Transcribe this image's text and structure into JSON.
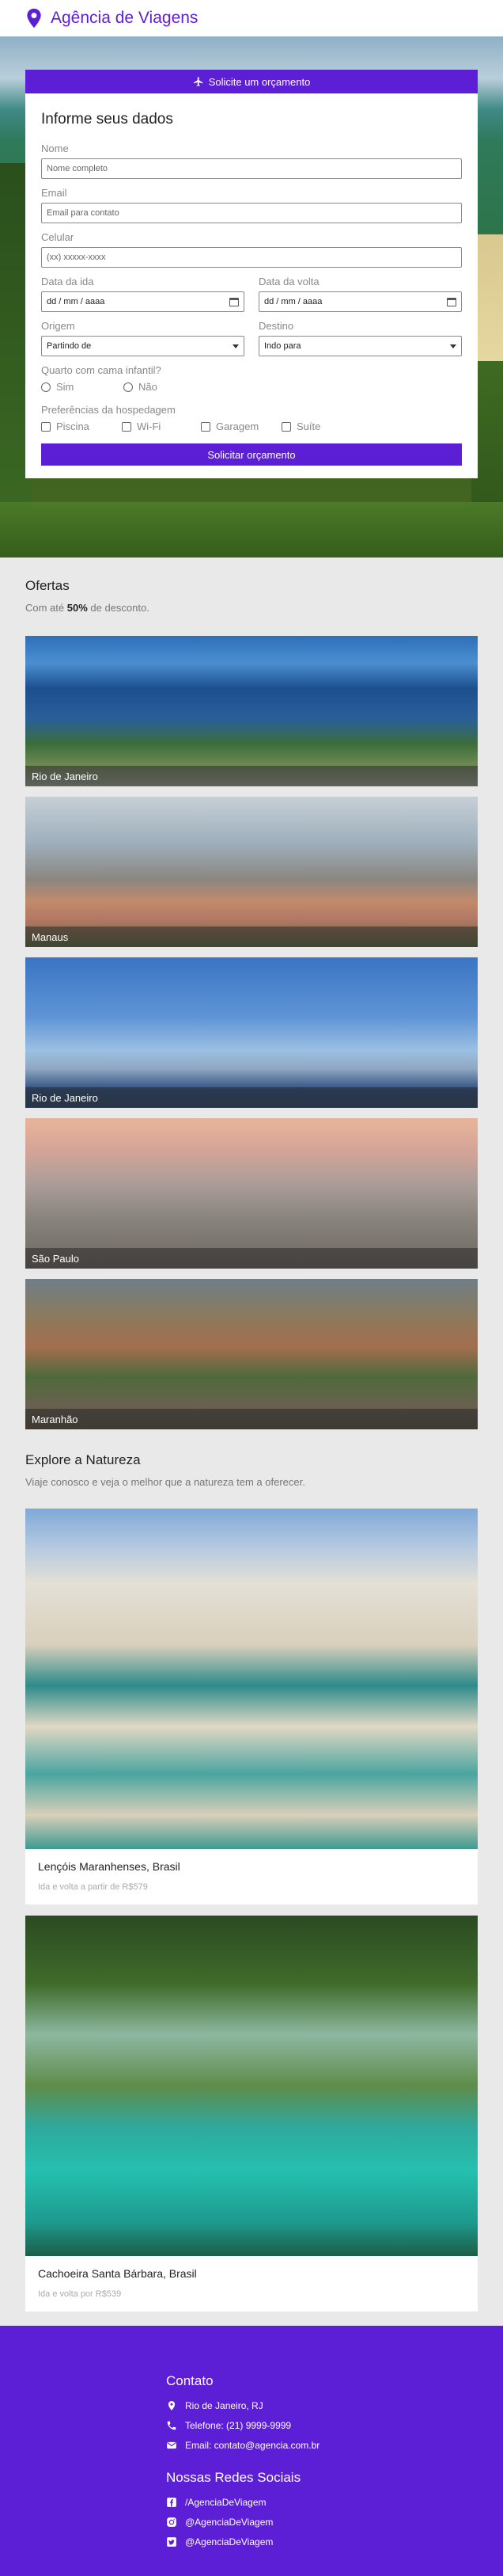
{
  "header": {
    "brand": "Agência de Viagens"
  },
  "quote": {
    "banner_label": "Solicite um orçamento",
    "title": "Informe seus dados",
    "name_label": "Nome",
    "name_placeholder": "Nome completo",
    "email_label": "Email",
    "email_placeholder": "Email para contato",
    "phone_label": "Celular",
    "phone_placeholder": "(xx) xxxxx-xxxx",
    "departure_label": "Data da ida",
    "return_label": "Data da volta",
    "date_placeholder": "dd / mm / aaaa",
    "origin_label": "Origem",
    "origin_value": "Partindo de",
    "destination_label": "Destino",
    "destination_value": "Indo para",
    "crib_question": "Quarto com cama infantil?",
    "crib_yes": "Sim",
    "crib_no": "Não",
    "prefs_label": "Preferências da hospedagem",
    "pref_pool": "Piscina",
    "pref_wifi": "Wi-Fi",
    "pref_garage": "Garagem",
    "pref_suite": "Suíte",
    "submit_label": "Solicitar orçamento"
  },
  "offers": {
    "title": "Ofertas",
    "subtitle_prefix": "Com até ",
    "subtitle_bold": "50%",
    "subtitle_suffix": " de desconto.",
    "items": [
      {
        "label": "Rio de Janeiro"
      },
      {
        "label": "Manaus"
      },
      {
        "label": "Rio de Janeiro"
      },
      {
        "label": "São Paulo"
      },
      {
        "label": "Maranhão"
      }
    ]
  },
  "nature": {
    "title": "Explore a Natureza",
    "subtitle": "Viaje conosco e veja o melhor que a natureza tem a oferecer.",
    "cards": [
      {
        "title": "Lençóis Maranhenses, Brasil",
        "price": "Ida e volta a partir de R$579"
      },
      {
        "title": "Cachoeira Santa Bárbara, Brasil",
        "price": "Ida e volta por R$539"
      }
    ]
  },
  "footer": {
    "contact_title": "Contato",
    "address": "Rio de Janeiro, RJ",
    "phone": "Telefone: (21) 9999-9999",
    "email": "Email: contato@agencia.com.br",
    "social_title": "Nossas Redes Sociais",
    "facebook": "/AgenciaDeViagem",
    "instagram": "@AgenciaDeViagem",
    "twitter": "@AgenciaDeViagem"
  },
  "colors": {
    "accent": "#5c1fd6",
    "background": "#e9e9e9"
  },
  "icons": [
    "map-pin-icon",
    "airplane-icon",
    "calendar-icon",
    "location-icon",
    "phone-icon",
    "mail-icon",
    "facebook-icon",
    "instagram-icon",
    "twitter-icon"
  ]
}
